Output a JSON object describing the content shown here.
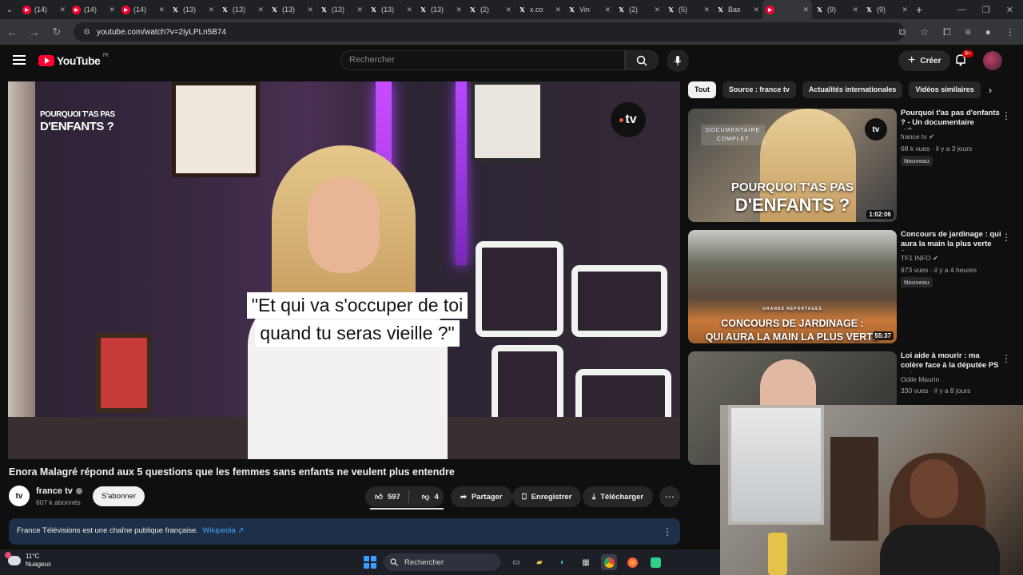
{
  "browser": {
    "tabs": [
      {
        "icon": "youtube-icon",
        "label": "(14)"
      },
      {
        "icon": "youtube-icon",
        "label": "(14)"
      },
      {
        "icon": "youtube-icon",
        "label": "(14)"
      },
      {
        "icon": "x-icon",
        "label": "(13)"
      },
      {
        "icon": "x-icon",
        "label": "(13)"
      },
      {
        "icon": "x-icon",
        "label": "(13)"
      },
      {
        "icon": "x-icon",
        "label": "(13)"
      },
      {
        "icon": "x-icon",
        "label": "(13)"
      },
      {
        "icon": "x-icon",
        "label": "(13)"
      },
      {
        "icon": "x-icon",
        "label": "(2)"
      },
      {
        "icon": "x-icon",
        "label": "x.co"
      },
      {
        "icon": "x-icon",
        "label": "Vin"
      },
      {
        "icon": "x-icon",
        "label": "(2)"
      },
      {
        "icon": "x-icon",
        "label": "(5)"
      },
      {
        "icon": "x-icon",
        "label": "Bas"
      },
      {
        "icon": "youtube-icon",
        "label": "",
        "active": true
      },
      {
        "icon": "x-icon",
        "label": "(9)"
      },
      {
        "icon": "x-icon",
        "label": "(9)"
      }
    ],
    "url": "youtube.com/watch?v=2iyLPLn5B74"
  },
  "youtube": {
    "logo_text": "YouTube",
    "region": "FR",
    "search_placeholder": "Rechercher",
    "create_label": "Créer",
    "notif_count": "9+"
  },
  "video": {
    "brand_title_line1": "POURQUOI T'AS PAS",
    "brand_title_line2": "D'ENFANTS ?",
    "channel_logo": "tv",
    "subtitle_line1": "\"Et qui va s'occuper de toi",
    "subtitle_line2": "quand tu seras vieille ?\"",
    "title": "Enora Malagré répond aux 5 questions que les femmes sans enfants ne veulent plus entendre",
    "channel_name": "france tv",
    "channel_avatar": "tv",
    "subscribers": "607 k abonnés",
    "subscribe_label": "S'abonner",
    "likes": "597",
    "dislikes": "4",
    "share_label": "Partager",
    "save_label": "Enregistrer",
    "download_label": "Télécharger",
    "info_text": "France Télévisions est une chaîne publique française.",
    "info_link": "Wikipedia ↗"
  },
  "sidebar": {
    "chips": [
      "Tout",
      "Source : france tv",
      "Actualités internationales",
      "Vidéos similaires"
    ],
    "recommendations": [
      {
        "title": "Pourquoi t'as pas d'enfants ? - Un documentaire d'Énor...",
        "channel": "france tv",
        "views": "68 k vues · il y a 3 jours",
        "badge": "Nouveau",
        "duration": "1:02:06",
        "thumb_tag_line1": "DOCUMENTAIRE",
        "thumb_tag_line2": "COMPLET",
        "thumb_text_line1": "POURQUOI T'AS PAS",
        "thumb_text_line2": "D'ENFANTS ?"
      },
      {
        "title": "Concours de jardinage : qui aura la main la plus verte ?...",
        "channel": "TF1 INFO",
        "views": "973 vues · il y a 4 heures",
        "badge": "Nouveau",
        "duration": "55:37",
        "thumb_tag_line1": "GRANDS REPORTAGES",
        "thumb_text_line1": "CONCOURS DE JARDINAGE :",
        "thumb_text_line2": "QUI AURA LA MAIN LA PLUS VERTE"
      },
      {
        "title": "Loi aide à mourir : ma colère face à la députée PS qui ...",
        "channel": "Odile Maurin",
        "views": "330 vues · il y a 8 jours"
      }
    ]
  },
  "taskbar": {
    "temperature": "11°C",
    "weather": "Nuageux",
    "search_label": "Rechercher"
  }
}
